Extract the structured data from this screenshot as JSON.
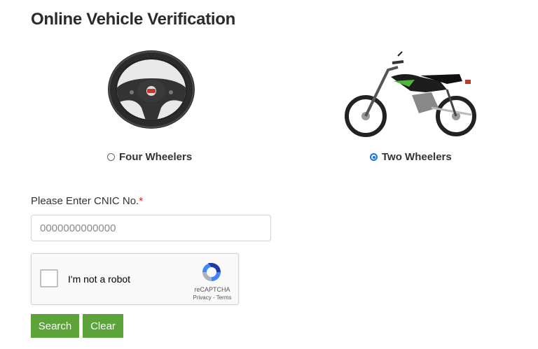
{
  "page_title": "Online Vehicle Verification",
  "vehicle_types": [
    {
      "label": "Four Wheelers",
      "image": "steering-wheel",
      "selected": false
    },
    {
      "label": "Two Wheelers",
      "image": "motorcycle",
      "selected": true
    }
  ],
  "cnic_field": {
    "label": "Please Enter CNIC No.",
    "required_mark": "*",
    "placeholder": "0000000000000",
    "value": ""
  },
  "recaptcha": {
    "label": "I'm not a robot",
    "brand": "reCAPTCHA",
    "links": "Privacy - Terms",
    "checked": false
  },
  "buttons": {
    "search_label": "Search",
    "clear_label": "Clear"
  },
  "colors": {
    "button_green": "#5ca33a",
    "radio_blue": "#1a73e8",
    "required_red": "#e02020"
  }
}
